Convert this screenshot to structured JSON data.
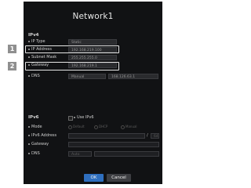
{
  "dialog": {
    "title": "Network1"
  },
  "ipv4": {
    "section_label": "IPv4",
    "ip_type": {
      "label": "IP Type",
      "value": "Static"
    },
    "ip_address": {
      "label": "IP Address",
      "value": "192.168.219.100"
    },
    "subnet_mask": {
      "label": "Subnet Mask",
      "value": "255.255.255.0"
    },
    "gateway": {
      "label": "Gateway",
      "value": "192.168.219.1"
    },
    "dns": {
      "label": "DNS",
      "mode": "Manual",
      "value": "168.126.63.1"
    }
  },
  "ipv6": {
    "section_label": "IPv6",
    "use_ipv6": {
      "label": "Use IPv6",
      "checked": false
    },
    "mode": {
      "label": "Mode",
      "options": [
        "Default",
        "DHCP",
        "Manual"
      ]
    },
    "ipv6_address": {
      "label": "IPv6 Address",
      "prefix": "64"
    },
    "gateway": {
      "label": "Gateway"
    },
    "dns": {
      "label": "DNS",
      "mode": "Auto"
    }
  },
  "markers": [
    "1",
    "2"
  ],
  "buttons": {
    "ok": "OK",
    "cancel": "Cancel"
  },
  "colors": {
    "panel_bg": "#111214",
    "field_bg": "#2a2b2e",
    "ok_button": "#2f6fbf",
    "marker_bg": "#8f8f8f"
  }
}
